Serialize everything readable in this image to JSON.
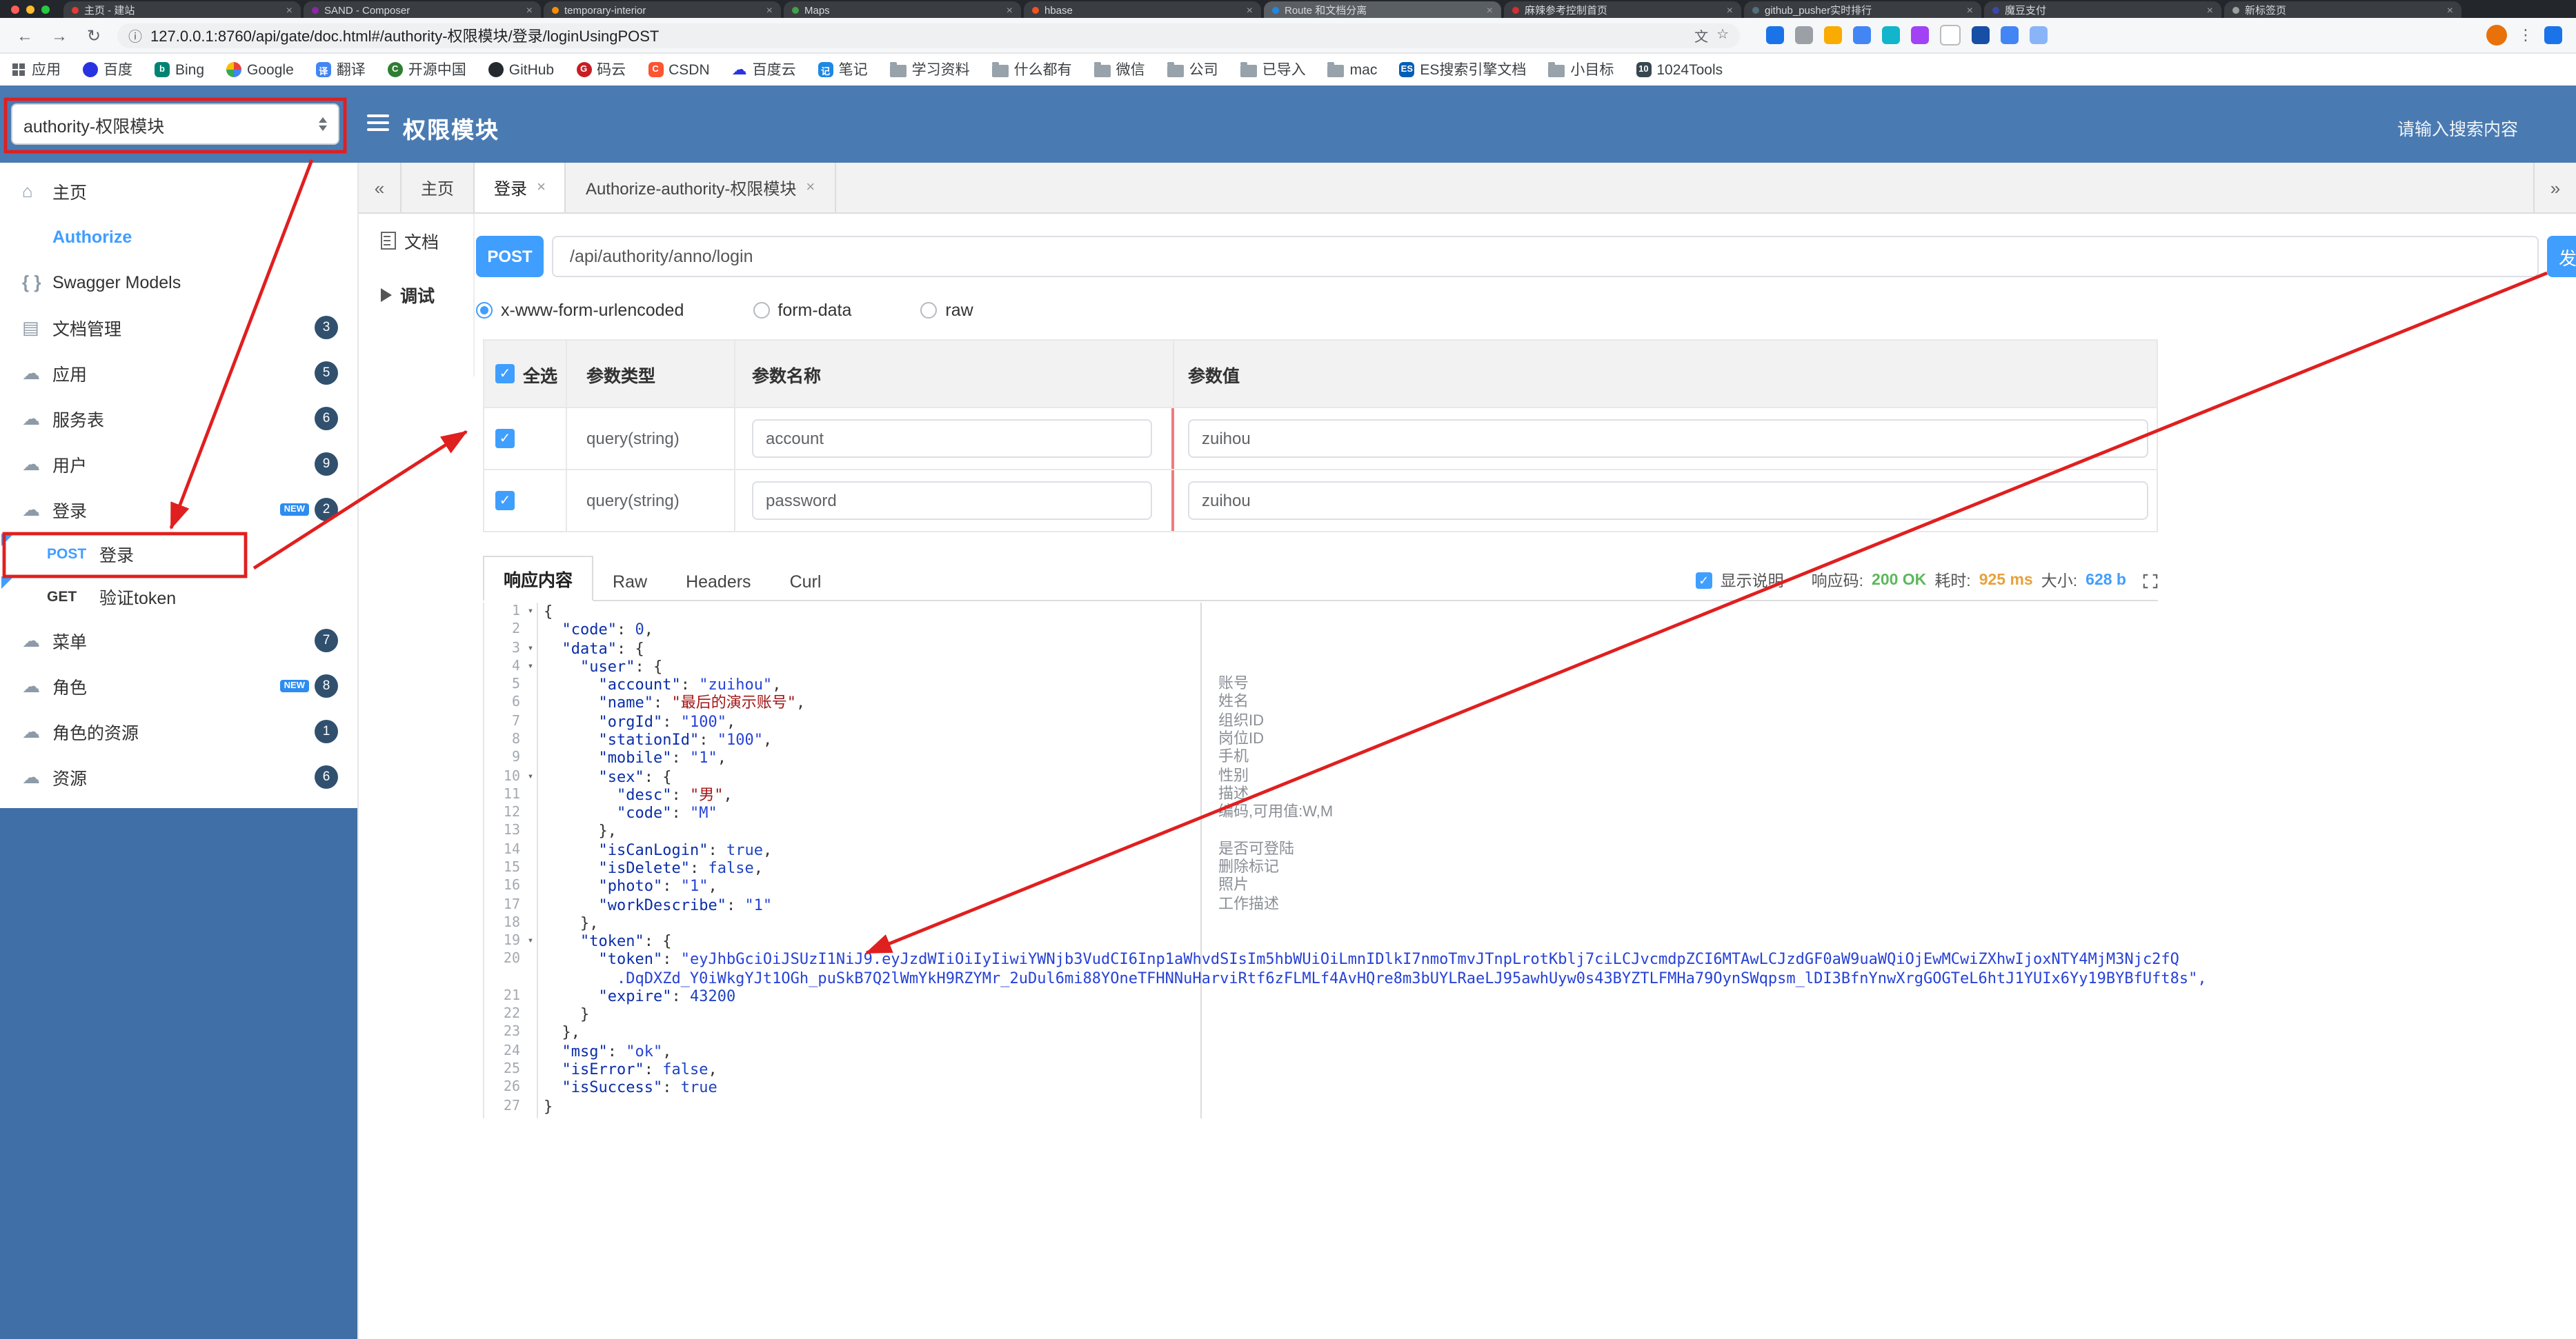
{
  "colors": {
    "header_blue": "#4a7ab2",
    "sidebar_blue": "#3f6fa6",
    "accent": "#409eff",
    "badge": "#30506e",
    "annotation_red": "#e01f1f",
    "ok_green": "#5cb85c",
    "time_orange": "#e6a23c",
    "size_blue": "#409eff",
    "code_key": "#0b2ea8",
    "code_string": "#2742d6",
    "code_cjk": "#a31515",
    "code_number": "#1e43c0"
  },
  "browser": {
    "tabs": [
      {
        "title": "主页 - 建站",
        "color": "#e53935"
      },
      {
        "title": "SAND - Composer",
        "color": "#8e24aa"
      },
      {
        "title": "temporary-interior",
        "color": "#fb8c00"
      },
      {
        "title": "Maps",
        "color": "#43a047"
      },
      {
        "title": "hbase",
        "color": "#f4511e"
      },
      {
        "title": "Route 和文档分离",
        "color": "#1e88e5",
        "active": true
      },
      {
        "title": "麻辣参考控制首页",
        "color": "#d32f2f"
      },
      {
        "title": "github_pusher实时排行",
        "color": "#546e7a"
      },
      {
        "title": "魔豆支付",
        "color": "#3949ab"
      },
      {
        "title": "新标签页",
        "color": "#9e9e9e"
      }
    ],
    "toolbar": {
      "url": "127.0.0.1:8760/api/gate/doc.html#/authority-权限模块/登录/loginUsingPOST",
      "translate_glyph": "文",
      "star_glyph": "☆"
    },
    "extension_icons": [
      {
        "name": "grid-extension-icon",
        "color": "#1a73e8"
      },
      {
        "name": "puzzle-extension-icon",
        "color": "#9aa0a6"
      },
      {
        "name": "orange-extension-icon",
        "color": "#f9ab00"
      },
      {
        "name": "google-extension-icon",
        "color": "#4285f4"
      },
      {
        "name": "teal-extension-icon",
        "color": "#12b5cb"
      },
      {
        "name": "purple-extension-icon",
        "color": "#a142f4"
      },
      {
        "name": "outline-extension-icon",
        "color": "#ffffff"
      },
      {
        "name": "shield-extension-icon",
        "color": "#174ea6"
      },
      {
        "name": "blue-extension-icon",
        "color": "#4285f4"
      },
      {
        "name": "snowflake-extension-icon",
        "color": "#8ab4f8"
      }
    ],
    "bookmarks": [
      {
        "label": "应用",
        "icon": "grid"
      },
      {
        "label": "百度",
        "icon": "circle",
        "color": "#2932e1"
      },
      {
        "label": "Bing",
        "icon": "square",
        "color": "#008373",
        "glyph": "b"
      },
      {
        "label": "Google",
        "icon": "google"
      },
      {
        "label": "翻译",
        "icon": "square",
        "color": "#4285f4",
        "glyph": "译"
      },
      {
        "label": "开源中国",
        "icon": "circle",
        "color": "#2e7d32",
        "glyph": "C"
      },
      {
        "label": "GitHub",
        "icon": "circle",
        "color": "#24292e"
      },
      {
        "label": "码云",
        "icon": "circle",
        "color": "#c71d23",
        "glyph": "G"
      },
      {
        "label": "CSDN",
        "icon": "square",
        "color": "#fc5531",
        "glyph": "C"
      },
      {
        "label": "百度云",
        "icon": "cloud",
        "color": "#2932e1"
      },
      {
        "label": "笔记",
        "icon": "square",
        "color": "#1e88e5",
        "glyph": "记"
      },
      {
        "label": "学习资料",
        "icon": "folder"
      },
      {
        "label": "什么都有",
        "icon": "folder"
      },
      {
        "label": "微信",
        "icon": "folder"
      },
      {
        "label": "公司",
        "icon": "folder"
      },
      {
        "label": "已导入",
        "icon": "folder"
      },
      {
        "label": "mac",
        "icon": "folder"
      },
      {
        "label": "ES搜索引擎文档",
        "icon": "square",
        "color": "#005eb8",
        "glyph": "ES"
      },
      {
        "label": "小目标",
        "icon": "folder"
      },
      {
        "label": "1024Tools",
        "icon": "square",
        "color": "#37474f",
        "glyph": "10"
      }
    ]
  },
  "header": {
    "group_select": "authority-权限模块",
    "title": "权限模块",
    "search_placeholder": "请输入搜索内容"
  },
  "sidebar": {
    "new_label": "NEW",
    "items": [
      {
        "label": "主页"
      },
      {
        "label": "Authorize"
      },
      {
        "label": "Swagger Models"
      },
      {
        "label": "文档管理",
        "badge": "3"
      },
      {
        "label": "应用",
        "badge": "5"
      },
      {
        "label": "服务表",
        "badge": "6"
      },
      {
        "label": "用户",
        "badge": "9"
      },
      {
        "label": "登录",
        "badge": "2",
        "new": true
      },
      {
        "label": "菜单",
        "badge": "7"
      },
      {
        "label": "角色",
        "badge": "8",
        "new": true
      },
      {
        "label": "角色的资源",
        "badge": "1"
      },
      {
        "label": "资源",
        "badge": "6"
      }
    ],
    "operations": [
      {
        "method": "POST",
        "label": "登录"
      },
      {
        "method": "GET",
        "label": "验证token"
      }
    ]
  },
  "tabs_bar": {
    "left_scroll": "«",
    "right_scroll": "»",
    "items": [
      {
        "label": "主页",
        "closable": false
      },
      {
        "label": "登录",
        "closable": true,
        "active": true
      },
      {
        "label": "Authorize-authority-权限模块",
        "closable": true
      }
    ]
  },
  "doc_nav": {
    "doc": "文档",
    "debug": "调试"
  },
  "endpoint": {
    "method": "POST",
    "url": "/api/authority/anno/login",
    "send_label": "发"
  },
  "body_type": {
    "options": [
      "x-www-form-urlencoded",
      "form-data",
      "raw"
    ],
    "selected": "x-www-form-urlencoded"
  },
  "params": {
    "header": {
      "all": "全选",
      "type": "参数类型",
      "name": "参数名称",
      "value": "参数值"
    },
    "rows": [
      {
        "checked": true,
        "type": "query(string)",
        "name": "account",
        "value": "zuihou"
      },
      {
        "checked": true,
        "type": "query(string)",
        "name": "password",
        "value": "zuihou"
      }
    ]
  },
  "response": {
    "tabs": [
      "响应内容",
      "Raw",
      "Headers",
      "Curl"
    ],
    "active_tab": "响应内容",
    "show_desc_label": "显示说明",
    "show_desc_checked": true,
    "meta": {
      "code_label": "响应码:",
      "code": "200 OK",
      "time_label": "耗时:",
      "time": "925 ms",
      "size_label": "大小:",
      "size": "628 b"
    },
    "lines": [
      {
        "n": 1,
        "fold": true,
        "p": [
          [
            "t",
            "{"
          ]
        ]
      },
      {
        "n": 2,
        "p": [
          [
            "t",
            "  "
          ],
          [
            "k",
            "\"code\""
          ],
          [
            "t",
            ": "
          ],
          [
            "n",
            "0"
          ],
          [
            "t",
            ","
          ]
        ]
      },
      {
        "n": 3,
        "fold": true,
        "p": [
          [
            "t",
            "  "
          ],
          [
            "k",
            "\"data\""
          ],
          [
            "t",
            ": {"
          ]
        ]
      },
      {
        "n": 4,
        "fold": true,
        "p": [
          [
            "t",
            "    "
          ],
          [
            "k",
            "\"user\""
          ],
          [
            "t",
            ": {"
          ]
        ]
      },
      {
        "n": 5,
        "p": [
          [
            "t",
            "      "
          ],
          [
            "k",
            "\"account\""
          ],
          [
            "t",
            ": "
          ],
          [
            "s",
            "\"zuihou\""
          ],
          [
            "t",
            ","
          ]
        ]
      },
      {
        "n": 6,
        "p": [
          [
            "t",
            "      "
          ],
          [
            "k",
            "\"name\""
          ],
          [
            "t",
            ": "
          ],
          [
            "z",
            "\"最后的演示账号\""
          ],
          [
            "t",
            ","
          ]
        ]
      },
      {
        "n": 7,
        "p": [
          [
            "t",
            "      "
          ],
          [
            "k",
            "\"orgId\""
          ],
          [
            "t",
            ": "
          ],
          [
            "s",
            "\"100\""
          ],
          [
            "t",
            ","
          ]
        ]
      },
      {
        "n": 8,
        "p": [
          [
            "t",
            "      "
          ],
          [
            "k",
            "\"stationId\""
          ],
          [
            "t",
            ": "
          ],
          [
            "s",
            "\"100\""
          ],
          [
            "t",
            ","
          ]
        ]
      },
      {
        "n": 9,
        "p": [
          [
            "t",
            "      "
          ],
          [
            "k",
            "\"mobile\""
          ],
          [
            "t",
            ": "
          ],
          [
            "s",
            "\"1\""
          ],
          [
            "t",
            ","
          ]
        ]
      },
      {
        "n": 10,
        "fold": true,
        "p": [
          [
            "t",
            "      "
          ],
          [
            "k",
            "\"sex\""
          ],
          [
            "t",
            ": {"
          ]
        ]
      },
      {
        "n": 11,
        "p": [
          [
            "t",
            "        "
          ],
          [
            "k",
            "\"desc\""
          ],
          [
            "t",
            ": "
          ],
          [
            "z",
            "\"男\""
          ],
          [
            "t",
            ","
          ]
        ]
      },
      {
        "n": 12,
        "p": [
          [
            "t",
            "        "
          ],
          [
            "k",
            "\"code\""
          ],
          [
            "t",
            ": "
          ],
          [
            "s",
            "\"M\""
          ]
        ]
      },
      {
        "n": 13,
        "p": [
          [
            "t",
            "      },"
          ]
        ]
      },
      {
        "n": 14,
        "p": [
          [
            "t",
            "      "
          ],
          [
            "k",
            "\"isCanLogin\""
          ],
          [
            "t",
            ": "
          ],
          [
            "b",
            "true"
          ],
          [
            "t",
            ","
          ]
        ]
      },
      {
        "n": 15,
        "p": [
          [
            "t",
            "      "
          ],
          [
            "k",
            "\"isDelete\""
          ],
          [
            "t",
            ": "
          ],
          [
            "b",
            "false"
          ],
          [
            "t",
            ","
          ]
        ]
      },
      {
        "n": 16,
        "p": [
          [
            "t",
            "      "
          ],
          [
            "k",
            "\"photo\""
          ],
          [
            "t",
            ": "
          ],
          [
            "s",
            "\"1\""
          ],
          [
            "t",
            ","
          ]
        ]
      },
      {
        "n": 17,
        "p": [
          [
            "t",
            "      "
          ],
          [
            "k",
            "\"workDescribe\""
          ],
          [
            "t",
            ": "
          ],
          [
            "s",
            "\"1\""
          ]
        ]
      },
      {
        "n": 18,
        "p": [
          [
            "t",
            "    },"
          ]
        ]
      },
      {
        "n": 19,
        "fold": true,
        "p": [
          [
            "t",
            "    "
          ],
          [
            "k",
            "\"token\""
          ],
          [
            "t",
            ": {"
          ]
        ]
      },
      {
        "n": 20,
        "p": [
          [
            "t",
            "      "
          ],
          [
            "k",
            "\"token\""
          ],
          [
            "t",
            ": "
          ],
          [
            "s",
            "\"eyJhbGciOiJSUzI1NiJ9.eyJzdWIiOiIyIiwiYWNjb3VudCI6Inp1aWhvdSIsIm5hbWUiOiLmnIDlkI7nmoTmvJTnpLrotKblj7ciLCJvcmdpZCI6MTAwLCJzdGF0aW9uaWQiOjEwMCwiZXhwIjoxNTY4MjM3Njc2fQ"
          ]
        ]
      },
      {
        "n": "",
        "p": [
          [
            "t",
            "        "
          ],
          [
            "s",
            ".DqDXZd_Y0iWkgYJt1OGh_puSkB7Q2lWmYkH9RZYMr_2uDul6mi88YOneTFHNNuHarviRtf6zFLMLf4AvHQre8m3bUYLRaeLJ95awhUyw0s43BYZTLFMHa79OynSWqpsm_lDI3BfnYnwXrgGOGTeL6htJ1YUIx6Yy19BYBfUft8s\","
          ]
        ]
      },
      {
        "n": 21,
        "p": [
          [
            "t",
            "      "
          ],
          [
            "k",
            "\"expire\""
          ],
          [
            "t",
            ": "
          ],
          [
            "n",
            "43200"
          ]
        ]
      },
      {
        "n": 22,
        "p": [
          [
            "t",
            "    }"
          ]
        ]
      },
      {
        "n": 23,
        "p": [
          [
            "t",
            "  },"
          ]
        ]
      },
      {
        "n": 24,
        "p": [
          [
            "t",
            "  "
          ],
          [
            "k",
            "\"msg\""
          ],
          [
            "t",
            ": "
          ],
          [
            "s",
            "\"ok\""
          ],
          [
            "t",
            ","
          ]
        ]
      },
      {
        "n": 25,
        "p": [
          [
            "t",
            "  "
          ],
          [
            "k",
            "\"isError\""
          ],
          [
            "t",
            ": "
          ],
          [
            "b",
            "false"
          ],
          [
            "t",
            ","
          ]
        ]
      },
      {
        "n": 26,
        "p": [
          [
            "t",
            "  "
          ],
          [
            "k",
            "\"isSuccess\""
          ],
          [
            "t",
            ": "
          ],
          [
            "b",
            "true"
          ]
        ]
      },
      {
        "n": 27,
        "p": [
          [
            "t",
            "}"
          ]
        ]
      }
    ],
    "annotations": [
      {
        "line": 5,
        "text": "账号"
      },
      {
        "line": 6,
        "text": "姓名"
      },
      {
        "line": 7,
        "text": "组织ID"
      },
      {
        "line": 8,
        "text": "岗位ID"
      },
      {
        "line": 9,
        "text": "手机"
      },
      {
        "line": 10,
        "text": "性别"
      },
      {
        "line": 11,
        "text": "描述"
      },
      {
        "line": 12,
        "text": "编码,可用值:W,M"
      },
      {
        "line": 14,
        "text": "是否可登陆"
      },
      {
        "line": 15,
        "text": "删除标记"
      },
      {
        "line": 16,
        "text": "照片"
      },
      {
        "line": 17,
        "text": "工作描述"
      }
    ]
  }
}
